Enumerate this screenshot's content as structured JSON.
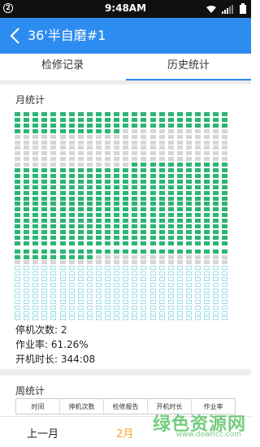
{
  "status_bar": {
    "badge": "2",
    "time": "9:48AM",
    "icons": [
      "wifi-icon",
      "signal-icon",
      "battery-icon"
    ]
  },
  "app_bar": {
    "title": "36'半自磨#1",
    "accent": "#2d8cf0"
  },
  "tabs": [
    {
      "label": "检修记录",
      "active": false
    },
    {
      "label": "历史统计",
      "active": true
    }
  ],
  "month": {
    "title": "月统计",
    "colors": {
      "running": "#2bb673",
      "stopped": "#d6d6d6",
      "future": "#9fe0ea"
    },
    "stats": [
      {
        "label": "停机次数:",
        "value": "2"
      },
      {
        "label": "作业率:",
        "value": "61.26%"
      },
      {
        "label": "开机时长:",
        "value": "344:08"
      }
    ]
  },
  "week": {
    "title": "周统计",
    "headers": [
      "时间",
      "停机次数",
      "检修报告",
      "开机时长",
      "作业率"
    ]
  },
  "bottom_bar": {
    "prev_label": "上一月",
    "current_label": "2月"
  },
  "watermark": {
    "text": "绿色资源网",
    "url": "www.downcc.com"
  }
}
